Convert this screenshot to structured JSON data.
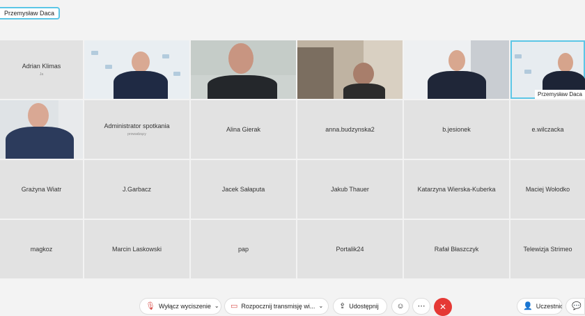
{
  "active_speaker": "Przemysław Daca",
  "participants": [
    {
      "name": "Adrian Klimas",
      "sub": "Ja"
    },
    {
      "name": ""
    },
    {
      "name": ""
    },
    {
      "name": ""
    },
    {
      "name": ""
    },
    {
      "name": "Przemysław Daca"
    },
    {
      "name": ""
    },
    {
      "name": "Administrator spotkania",
      "sub": "prowadzący"
    },
    {
      "name": "Alina Gierak"
    },
    {
      "name": "anna.budzynska2"
    },
    {
      "name": "b.jesionek"
    },
    {
      "name": "e.wilczacka"
    },
    {
      "name": "Grażyna Wiatr"
    },
    {
      "name": "J.Garbacz"
    },
    {
      "name": "Jacek Sałaputa"
    },
    {
      "name": "Jakub Thauer"
    },
    {
      "name": "Katarzyna Wierska-Kuberka"
    },
    {
      "name": "Maciej Wołodko"
    },
    {
      "name": "magkoz"
    },
    {
      "name": "Marcin Laskowski"
    },
    {
      "name": "pap"
    },
    {
      "name": "Portalik24"
    },
    {
      "name": "Rafał Błaszczyk"
    },
    {
      "name": "Telewizja Strimeo"
    }
  ],
  "toolbar": {
    "mute": "Wyłącz wyciszenie",
    "record": "Rozpocznij transmisję wi...",
    "share": "Udostępnij",
    "participants": "Uczestnicy",
    "chat": "Cz"
  },
  "icons": {
    "mic": "mic-icon",
    "video": "video-camera-icon",
    "share": "share-icon",
    "reactions": "smiley-icon",
    "more": "more-icon",
    "end": "close-icon",
    "people": "person-icon",
    "chat": "chat-icon"
  },
  "colors": {
    "active_outline": "#5bc6e6",
    "end_call": "#e53935",
    "tile_bg": "#e2e2e2"
  }
}
